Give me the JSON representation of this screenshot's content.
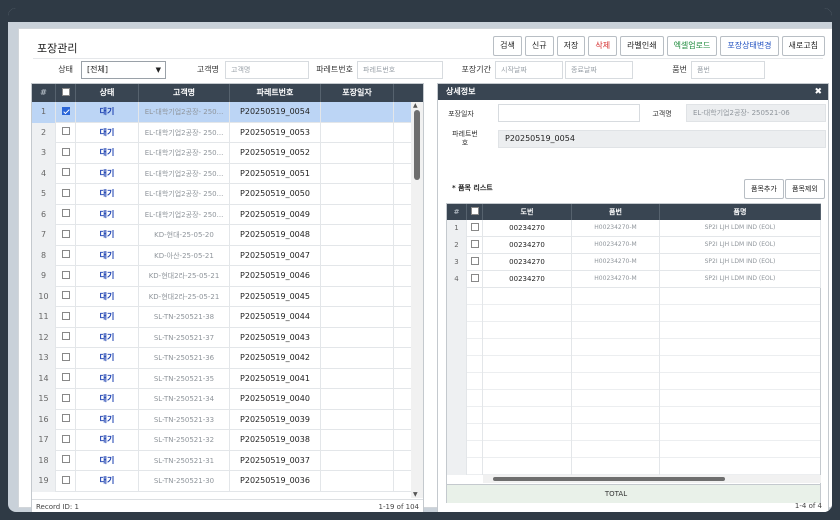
{
  "title": "포장관리",
  "toolbar": {
    "buttons": [
      "검색",
      "신규",
      "저장",
      "삭제",
      "라벨인쇄",
      "엑셀업로드",
      "포장상태변경",
      "새로고침"
    ]
  },
  "filters": {
    "status_label": "상태",
    "status_value": "[전체]",
    "customer_label": "고객명",
    "customer_placeholder": "고객명",
    "pallet_label": "파레트번호",
    "pallet_placeholder": "파레트번호",
    "period_label": "포장기간",
    "start_placeholder": "시작날짜",
    "end_placeholder": "종료날짜",
    "item_label": "품번",
    "item_placeholder": "품번"
  },
  "left_grid": {
    "columns": [
      "#",
      "상태",
      "고객명",
      "파레트번호",
      "포장일자"
    ],
    "rows": [
      {
        "num": "1",
        "status": "대기",
        "customer": "EL-대학기업2공장- 250...",
        "pallet": "P20250519_0054",
        "checked": true
      },
      {
        "num": "2",
        "status": "대기",
        "customer": "EL-대학기업2공장- 250...",
        "pallet": "P20250519_0053",
        "checked": false
      },
      {
        "num": "3",
        "status": "대기",
        "customer": "EL-대학기업2공장- 250...",
        "pallet": "P20250519_0052",
        "checked": false
      },
      {
        "num": "4",
        "status": "대기",
        "customer": "EL-대학기업2공장- 250...",
        "pallet": "P20250519_0051",
        "checked": false
      },
      {
        "num": "5",
        "status": "대기",
        "customer": "EL-대학기업2공장- 250...",
        "pallet": "P20250519_0050",
        "checked": false
      },
      {
        "num": "6",
        "status": "대기",
        "customer": "EL-대학기업2공장- 250...",
        "pallet": "P20250519_0049",
        "checked": false
      },
      {
        "num": "7",
        "status": "대기",
        "customer": "KD-현대-25-05-20",
        "pallet": "P20250519_0048",
        "checked": false
      },
      {
        "num": "8",
        "status": "대기",
        "customer": "KD-아산-25-05-21",
        "pallet": "P20250519_0047",
        "checked": false
      },
      {
        "num": "9",
        "status": "대기",
        "customer": "KD-현대2라-25-05-21",
        "pallet": "P20250519_0046",
        "checked": false
      },
      {
        "num": "10",
        "status": "대기",
        "customer": "KD-현대2라-25-05-21",
        "pallet": "P20250519_0045",
        "checked": false
      },
      {
        "num": "11",
        "status": "대기",
        "customer": "SL-TN-250521-38",
        "pallet": "P20250519_0044",
        "checked": false
      },
      {
        "num": "12",
        "status": "대기",
        "customer": "SL-TN-250521-37",
        "pallet": "P20250519_0043",
        "checked": false
      },
      {
        "num": "13",
        "status": "대기",
        "customer": "SL-TN-250521-36",
        "pallet": "P20250519_0042",
        "checked": false
      },
      {
        "num": "14",
        "status": "대기",
        "customer": "SL-TN-250521-35",
        "pallet": "P20250519_0041",
        "checked": false
      },
      {
        "num": "15",
        "status": "대기",
        "customer": "SL-TN-250521-34",
        "pallet": "P20250519_0040",
        "checked": false
      },
      {
        "num": "16",
        "status": "대기",
        "customer": "SL-TN-250521-33",
        "pallet": "P20250519_0039",
        "checked": false
      },
      {
        "num": "17",
        "status": "대기",
        "customer": "SL-TN-250521-32",
        "pallet": "P20250519_0038",
        "checked": false
      },
      {
        "num": "18",
        "status": "대기",
        "customer": "SL-TN-250521-31",
        "pallet": "P20250519_0037",
        "checked": false
      },
      {
        "num": "19",
        "status": "대기",
        "customer": "SL-TN-250521-30",
        "pallet": "P20250519_0036",
        "checked": false
      }
    ],
    "record_id": "Record ID: 1",
    "paging": "1-19 of 104"
  },
  "detail": {
    "title": "상세정보",
    "pack_date_label": "포장일자",
    "customer_label": "고객명",
    "customer_value": "EL-대학기업2공장- 250521-06",
    "pallet_label": "파레트번호",
    "pallet_value": "P20250519_0054",
    "item_list_label": "* 품목 리스트",
    "add_button": "품목추가",
    "remove_button": "품목제외",
    "columns": [
      "#",
      "도번",
      "품번",
      "품명"
    ],
    "items": [
      {
        "num": "1",
        "drawing": "00234270",
        "part": "H00234270-M",
        "name": "SP2I LJH LDM IND (EOL)"
      },
      {
        "num": "2",
        "drawing": "00234270",
        "part": "H00234270-M",
        "name": "SP2I LJH LDM IND (EOL)"
      },
      {
        "num": "3",
        "drawing": "00234270",
        "part": "H00234270-M",
        "name": "SP2I LJH LDM IND (EOL)"
      },
      {
        "num": "4",
        "drawing": "00234270",
        "part": "H00234270-M",
        "name": "SP2I LJH LDM IND (EOL)"
      }
    ],
    "total_label": "TOTAL",
    "paging": "1-4 of 4"
  }
}
